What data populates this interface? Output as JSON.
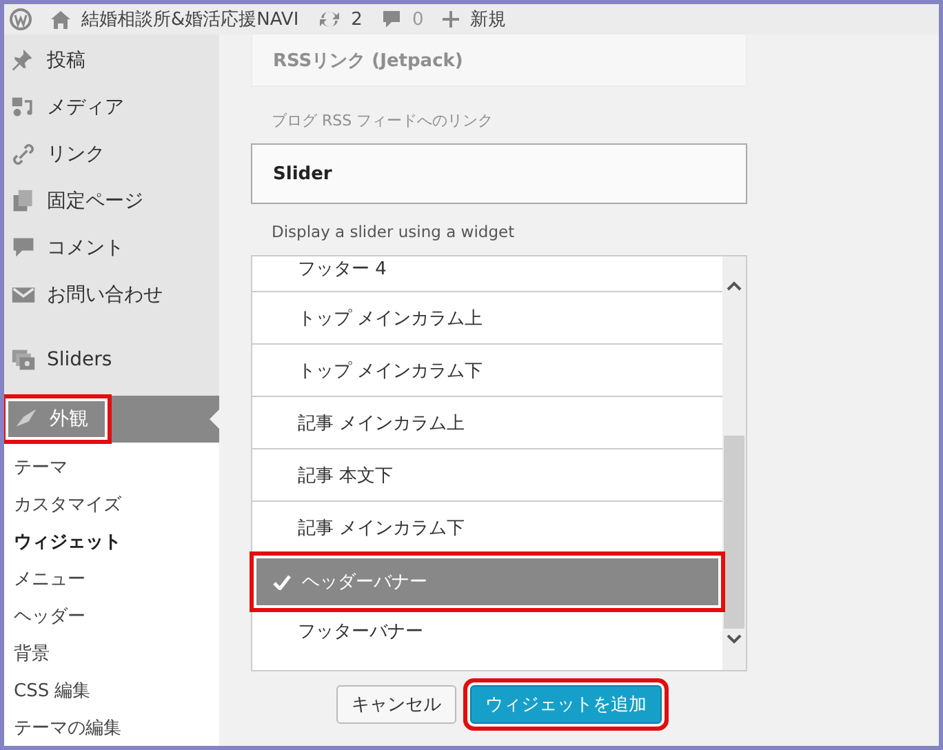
{
  "admin_bar": {
    "site_name": "結婚相談所&婚活応援NAVI",
    "updates": "2",
    "comments": "0",
    "new_label": "新規"
  },
  "sidebar": {
    "items": [
      {
        "label": "投稿",
        "selected": false,
        "highlighted": false
      },
      {
        "label": "メディア",
        "selected": false,
        "highlighted": false
      },
      {
        "label": "リンク",
        "selected": false,
        "highlighted": false
      },
      {
        "label": "固定ページ",
        "selected": false,
        "highlighted": false
      },
      {
        "label": "コメント",
        "selected": false,
        "highlighted": false
      },
      {
        "label": "お問い合わせ",
        "selected": false,
        "highlighted": false
      },
      {
        "label": "Sliders",
        "selected": false,
        "highlighted": false
      },
      {
        "label": "外観",
        "selected": true,
        "highlighted": true
      }
    ],
    "submenu": [
      {
        "label": "テーマ",
        "selected": false
      },
      {
        "label": "カスタマイズ",
        "selected": false
      },
      {
        "label": "ウィジェット",
        "selected": true
      },
      {
        "label": "メニュー",
        "selected": false
      },
      {
        "label": "ヘッダー",
        "selected": false
      },
      {
        "label": "背景",
        "selected": false
      },
      {
        "label": "CSS 編集",
        "selected": false
      },
      {
        "label": "テーマの編集",
        "selected": false
      }
    ]
  },
  "faded_widget": {
    "title": "RSSリンク (Jetpack)",
    "description": "ブログ RSS フィードへのリンク"
  },
  "widget": {
    "title": "Slider",
    "description": "Display a slider using a widget"
  },
  "areas": [
    {
      "label": "フッター 4",
      "selected": false,
      "highlighted": false
    },
    {
      "label": "トップ メインカラム上",
      "selected": false,
      "highlighted": false
    },
    {
      "label": "トップ メインカラム下",
      "selected": false,
      "highlighted": false
    },
    {
      "label": "記事 メインカラム上",
      "selected": false,
      "highlighted": false
    },
    {
      "label": "記事 本文下",
      "selected": false,
      "highlighted": false
    },
    {
      "label": "記事 メインカラム下",
      "selected": false,
      "highlighted": false
    },
    {
      "label": "ヘッダーバナー",
      "selected": true,
      "highlighted": true
    },
    {
      "label": "フッターバナー",
      "selected": false,
      "highlighted": false
    }
  ],
  "buttons": [
    {
      "label": "キャンセル",
      "kind": "secondary",
      "highlighted": false
    },
    {
      "label": "ウィジェットを追加",
      "kind": "primary",
      "highlighted": true
    }
  ]
}
